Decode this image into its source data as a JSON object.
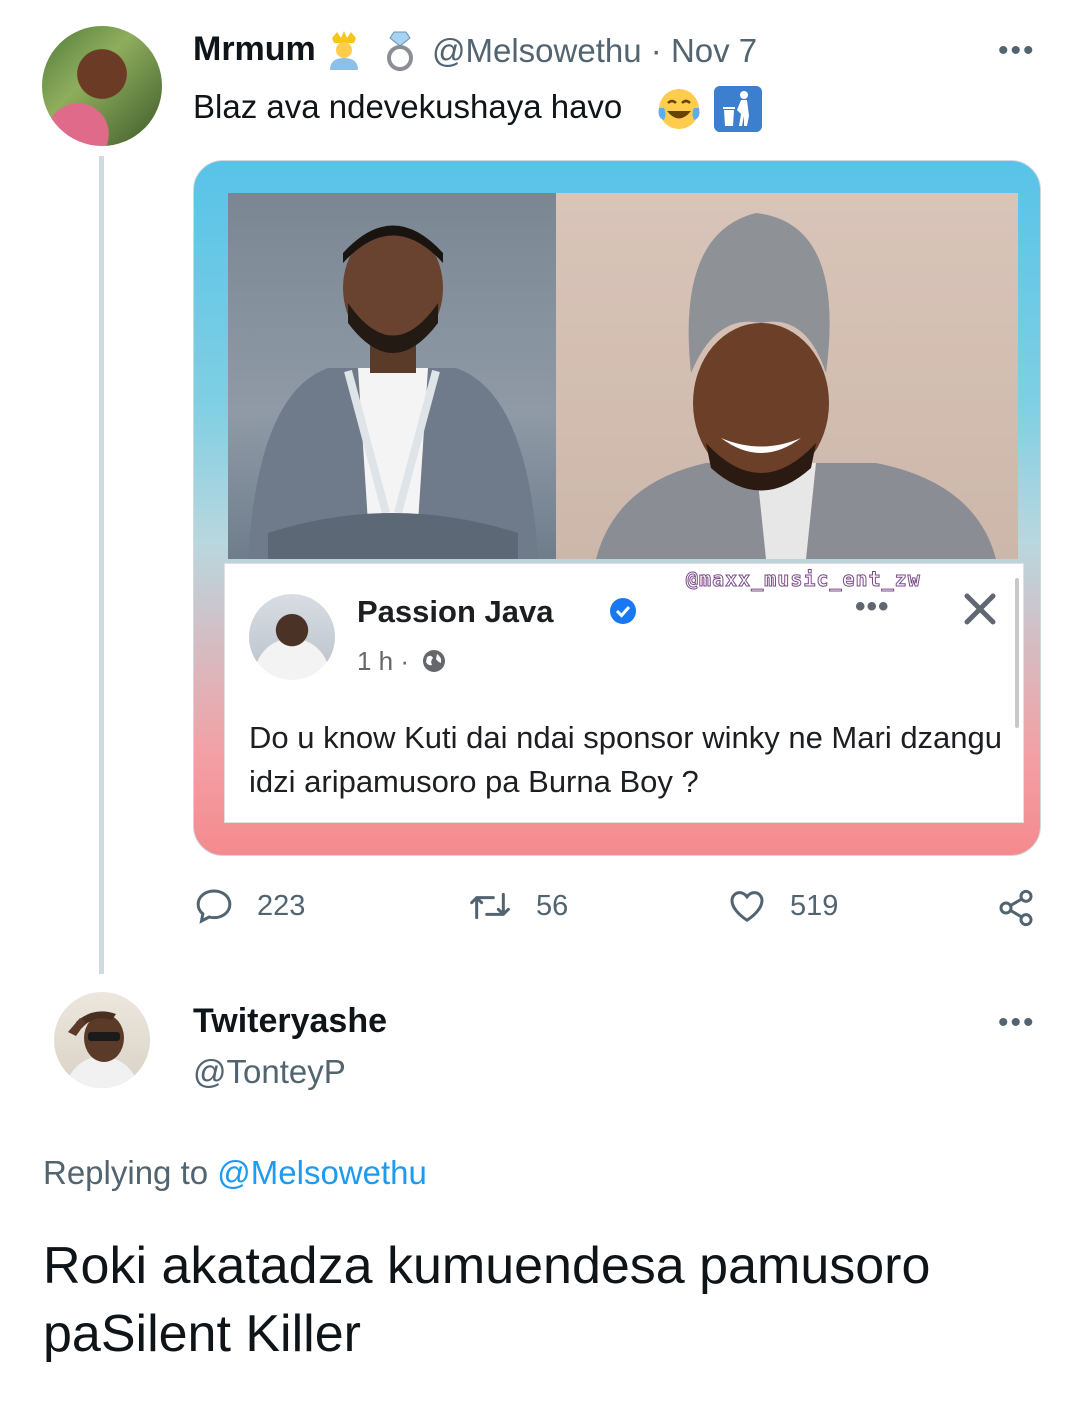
{
  "tweet": {
    "author_name": "Mrmum",
    "author_handle": "@Melsowethu",
    "separator": "·",
    "date": "Nov 7",
    "text": "Blaz ava ndevekushaya havo",
    "name_emojis": [
      "person-with-crown-emoji",
      "ring-emoji"
    ],
    "text_emojis": [
      "tears-of-joy-emoji",
      "litter-in-bin-emoji"
    ],
    "more_label": "•••",
    "media": {
      "watermark": "@maxx_music_ent_zw",
      "facebook_post": {
        "page_name": "Passion Java",
        "verified": true,
        "time": "1 h ·",
        "dots": "•••",
        "text": "Do u know Kuti dai ndai sponsor winky ne Mari dzangu idzi aripamusoro pa Burna Boy ?"
      }
    },
    "actions": {
      "replies": "223",
      "retweets": "56",
      "likes": "519"
    }
  },
  "reply": {
    "author_name": "Twiteryashe",
    "author_handle": "@TonteyP",
    "more_label": "•••",
    "replying_prefix": "Replying to",
    "replying_to": "@Melsowethu",
    "text": "Roki akatadza kumuendesa pamusoro paSilent Killer"
  },
  "colors": {
    "text_primary": "#0f1419",
    "text_secondary": "#536471",
    "accent": "#1d9bf0",
    "fb_verified": "#1877f2"
  }
}
